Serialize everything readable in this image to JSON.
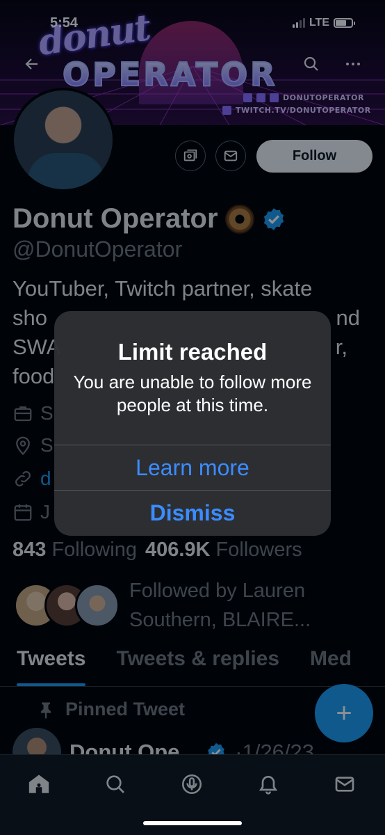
{
  "status_bar": {
    "time": "5:54",
    "network": "LTE"
  },
  "banner": {
    "logo_script": "donut",
    "logo_main": "OPERATOR",
    "social_handle": "DONUTOPERATOR",
    "twitch_url": "TWITCH.TV/DONUTOPERATOR"
  },
  "profile": {
    "follow_label": "Follow",
    "display_name": "Donut Operator",
    "handle": "@DonutOperator",
    "bio_lines": [
      "YouTuber, Twitch partner, skate",
      "sho",
      "nd",
      "SWA",
      "r,",
      "food"
    ],
    "meta": {
      "category": "S",
      "location": "S",
      "link": "d",
      "joined": "J"
    },
    "following_count": "843",
    "following_label": "Following",
    "followers_count": "406.9K",
    "followers_label": "Followers",
    "followed_by": "Followed by Lauren Southern, BLAIRE..."
  },
  "tabs": [
    "Tweets",
    "Tweets & replies",
    "Med"
  ],
  "pinned_label": "Pinned Tweet",
  "tweet": {
    "author": "Donut Ope...",
    "date": "·1/26/23"
  },
  "alert": {
    "title": "Limit reached",
    "message": "You are unable to follow more people at this time.",
    "learn_more": "Learn more",
    "dismiss": "Dismiss"
  },
  "icons": [
    "back-arrow-icon",
    "search-icon",
    "more-icon",
    "messages-icon",
    "mail-icon",
    "verified-badge-icon",
    "briefcase-icon",
    "location-pin-icon",
    "link-icon",
    "calendar-icon",
    "pin-icon",
    "compose-plus-icon",
    "home-icon",
    "spaces-icon",
    "notifications-bell-icon",
    "inbox-mail-icon"
  ],
  "colors": {
    "accent": "#1d9bf0",
    "alert_button": "#3b8cff",
    "background": "#000000",
    "secondary_text": "#71767b"
  }
}
